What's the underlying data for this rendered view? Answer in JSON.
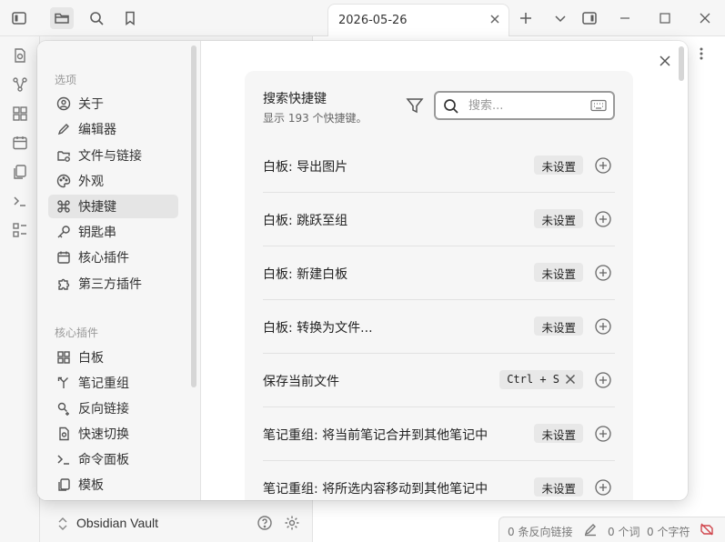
{
  "window": {
    "tab_title": "2026-05-26"
  },
  "vault": {
    "name": "Obsidian Vault"
  },
  "status_bar": {
    "backlinks": "0 条反向链接",
    "words": "0 个词",
    "chars": "0 个字符"
  },
  "settings_nav": {
    "options_heading": "选项",
    "options": [
      {
        "label": "关于",
        "icon": "info-circle-icon"
      },
      {
        "label": "编辑器",
        "icon": "pencil-icon"
      },
      {
        "label": "文件与链接",
        "icon": "folder-link-icon"
      },
      {
        "label": "外观",
        "icon": "palette-icon"
      },
      {
        "label": "快捷键",
        "icon": "command-icon",
        "active": true
      },
      {
        "label": "钥匙串",
        "icon": "key-icon"
      },
      {
        "label": "核心插件",
        "icon": "calendar-box-icon"
      },
      {
        "label": "第三方插件",
        "icon": "puzzle-icon"
      }
    ],
    "core_heading": "核心插件",
    "core": [
      {
        "label": "白板",
        "icon": "canvas-grid-icon"
      },
      {
        "label": "笔记重组",
        "icon": "merge-icon"
      },
      {
        "label": "反向链接",
        "icon": "backlink-icon"
      },
      {
        "label": "快速切换",
        "icon": "quick-switch-icon"
      },
      {
        "label": "命令面板",
        "icon": "terminal-icon"
      },
      {
        "label": "模板",
        "icon": "copy-icon"
      }
    ]
  },
  "hotkeys": {
    "title": "搜索快捷键",
    "subtitle": "显示 193 个快捷键。",
    "search_placeholder": "搜索...",
    "rows": [
      {
        "label": "白板: 导出图片",
        "hotkey": "未设置",
        "set": false
      },
      {
        "label": "白板: 跳跃至组",
        "hotkey": "未设置",
        "set": false
      },
      {
        "label": "白板: 新建白板",
        "hotkey": "未设置",
        "set": false
      },
      {
        "label": "白板: 转换为文件...",
        "hotkey": "未设置",
        "set": false
      },
      {
        "label": "保存当前文件",
        "hotkey": "Ctrl + S",
        "set": true
      },
      {
        "label": "笔记重组: 将当前笔记合并到其他笔记中",
        "hotkey": "未设置",
        "set": false
      },
      {
        "label": "笔记重组: 将所选内容移动到其他笔记中",
        "hotkey": "未设置",
        "set": false
      }
    ]
  }
}
